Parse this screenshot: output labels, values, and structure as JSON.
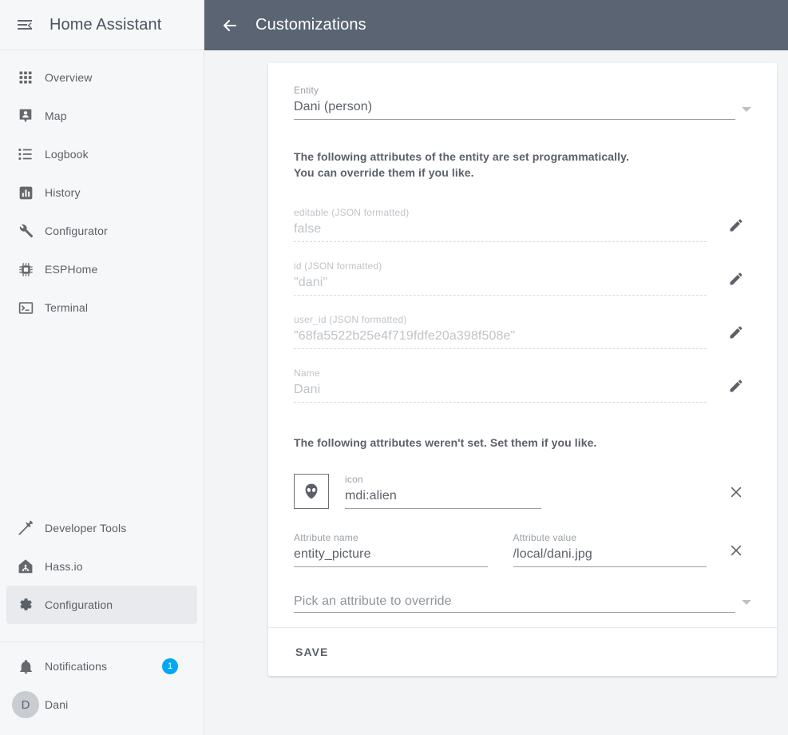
{
  "sidebar": {
    "menu_icon": "menu-open-icon",
    "title": "Home Assistant",
    "items": [
      {
        "label": "Overview",
        "icon": "view-dashboard-icon"
      },
      {
        "label": "Map",
        "icon": "map-marker-account-icon"
      },
      {
        "label": "Logbook",
        "icon": "format-list-bulleted-icon"
      },
      {
        "label": "History",
        "icon": "chart-box-icon"
      },
      {
        "label": "Configurator",
        "icon": "wrench-icon"
      },
      {
        "label": "ESPHome",
        "icon": "chip-icon"
      },
      {
        "label": "Terminal",
        "icon": "console-icon"
      }
    ],
    "lower_items": [
      {
        "label": "Developer Tools",
        "icon": "hammer-icon",
        "active": false
      },
      {
        "label": "Hass.io",
        "icon": "hassio-icon",
        "active": false
      },
      {
        "label": "Configuration",
        "icon": "cog-icon",
        "active": true
      }
    ],
    "notifications": {
      "label": "Notifications",
      "icon": "bell-icon",
      "count": "1"
    },
    "user": {
      "label": "Dani",
      "initial": "D"
    }
  },
  "toolbar": {
    "back_icon": "arrow-left-icon",
    "title": "Customizations"
  },
  "form": {
    "entity": {
      "label": "Entity",
      "value": "Dani (person)"
    },
    "note_set": "The following attributes of the entity are set programmatically.\nYou can override them if you like.",
    "note_unset": "The following attributes weren't set. Set them if you like.",
    "programmatic_attributes": [
      {
        "label": "editable (JSON formatted)",
        "value": "false"
      },
      {
        "label": "id (JSON formatted)",
        "value": "\"dani\""
      },
      {
        "label": "user_id (JSON formatted)",
        "value": "\"68fa5522b25e4f719fdfe20a398f508e\""
      },
      {
        "label": "Name",
        "value": "Dani"
      }
    ],
    "edit_icon": "pencil-icon",
    "remove_icon": "close-icon",
    "icon_attribute": {
      "label": "icon",
      "value": "mdi:alien",
      "preview_icon": "alien-icon"
    },
    "custom_attribute": {
      "name_label": "Attribute name",
      "name_value": "entity_picture",
      "value_label": "Attribute value",
      "value_value": "/local/dani.jpg"
    },
    "picker": {
      "placeholder": "Pick an attribute to override",
      "caret_icon": "chevron-down-icon"
    },
    "save_label": "SAVE"
  },
  "colors": {
    "toolbar_bg": "#5a6472",
    "page_bg": "#f2f4f6",
    "sidebar_bg": "#f6f7f8",
    "badge": "#03a9f4",
    "active_row": "#e8eaed",
    "text": "#5b6068"
  }
}
